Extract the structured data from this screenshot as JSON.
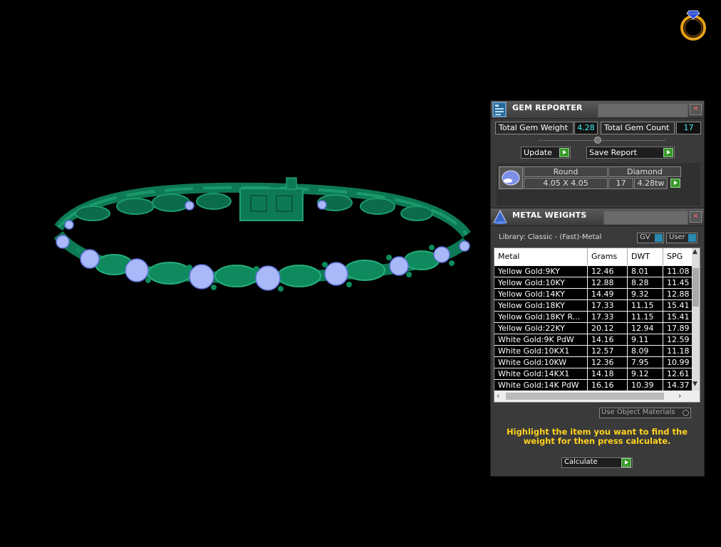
{
  "gem_reporter": {
    "title": "GEM REPORTER",
    "total_weight_label": "Total Gem Weight",
    "total_weight_value": "4.28",
    "total_count_label": "Total Gem Count",
    "total_count_value": "17",
    "update_label": "Update",
    "save_report_label": "Save Report",
    "gem_row": {
      "shape": "Round",
      "material": "Diamond",
      "size": "4.05 X 4.05",
      "count": "17",
      "weight": "4.28tw"
    }
  },
  "metal_weights": {
    "title": "METAL WEIGHTS",
    "library": "Library: Classic - (Fast)-Metal",
    "gv_label": "GV",
    "user_label": "User",
    "columns": [
      "Metal",
      "Grams",
      "DWT",
      "SPG"
    ],
    "rows": [
      {
        "metal": "Yellow Gold:9KY",
        "grams": "12.46",
        "dwt": "8.01",
        "spg": "11.08"
      },
      {
        "metal": "Yellow Gold:10KY",
        "grams": "12.88",
        "dwt": "8.28",
        "spg": "11.45"
      },
      {
        "metal": "Yellow Gold:14KY",
        "grams": "14.49",
        "dwt": "9.32",
        "spg": "12.88"
      },
      {
        "metal": "Yellow Gold:18KY",
        "grams": "17.33",
        "dwt": "11.15",
        "spg": "15.41"
      },
      {
        "metal": "Yellow Gold:18KY R...",
        "grams": "17.33",
        "dwt": "11.15",
        "spg": "15.41"
      },
      {
        "metal": "Yellow Gold:22KY",
        "grams": "20.12",
        "dwt": "12.94",
        "spg": "17.89"
      },
      {
        "metal": "White Gold:9K PdW",
        "grams": "14.16",
        "dwt": "9.11",
        "spg": "12.59"
      },
      {
        "metal": "White Gold:10KX1",
        "grams": "12.57",
        "dwt": "8.09",
        "spg": "11.18"
      },
      {
        "metal": "White Gold:10KW",
        "grams": "12.36",
        "dwt": "7.95",
        "spg": "10.99"
      },
      {
        "metal": "White Gold:14KX1",
        "grams": "14.18",
        "dwt": "9.12",
        "spg": "12.61"
      },
      {
        "metal": "White Gold:14K PdW",
        "grams": "16.16",
        "dwt": "10.39",
        "spg": "14.37"
      }
    ],
    "use_object_materials": "Use Object Materials",
    "hint": "Highlight the item you want to find the weight for then press calculate.",
    "calculate_label": "Calculate"
  },
  "colors": {
    "bracelet": "#0d7a55",
    "gem": "#a9b8f8",
    "hint": "#ffd21e",
    "value": "#3cf0f0",
    "go_button": "#3a9a2a"
  }
}
